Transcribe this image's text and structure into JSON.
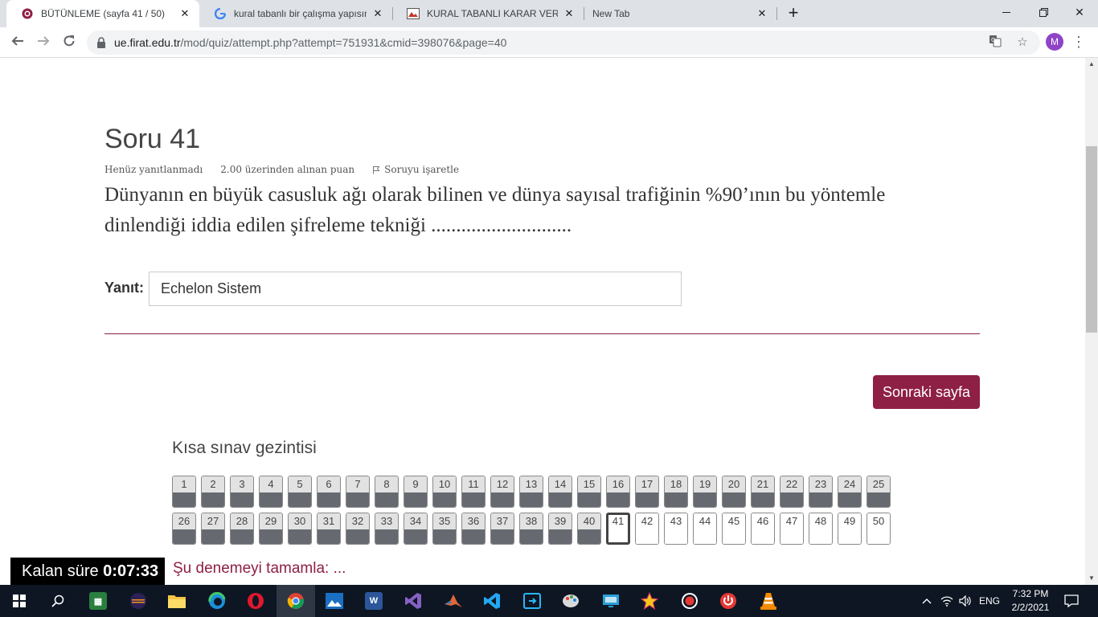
{
  "browser": {
    "tabs": [
      {
        "title": "BÜTÜNLEME (sayfa 41 / 50)",
        "active": true
      },
      {
        "title": "kural tabanlı bir çalışma yapısına",
        "active": false
      },
      {
        "title": "KURAL TABANLI KARAR VERME M",
        "active": false
      },
      {
        "title": "New Tab",
        "active": false
      }
    ],
    "url_host": "ue.firat.edu.tr",
    "url_path": "/mod/quiz/attempt.php?attempt=751931&cmid=398076&page=40",
    "profile_initial": "M",
    "new_tab_symbol": "+"
  },
  "question": {
    "title": "Soru 41",
    "status": "Henüz yanıtlanmadı",
    "points": "2.00 üzerinden alınan puan",
    "flag_label": "Soruyu işaretle",
    "text": "Dünyanın en büyük casusluk ağı olarak bilinen ve dünya sayısal trafiğinin %90’ının bu yöntemle dinlendiği iddia edilen şifreleme tekniği ............................",
    "answer_label": "Yanıt:",
    "answer_value": "Echelon Sistem"
  },
  "next_button": "Sonraki sayfa",
  "quiz_nav": {
    "title": "Kısa sınav gezintisi",
    "current": 41,
    "answered_through": 40,
    "total": 50
  },
  "finish_link": "Şu denemeyi tamamla: ...",
  "timer": {
    "label": "Kalan süre",
    "value": "0:07:33"
  },
  "taskbar": {
    "language": "ENG",
    "time": "7:32 PM",
    "date": "2/2/2021"
  },
  "colors": {
    "accent": "#8e1f45",
    "answered_bar": "#666a70"
  }
}
